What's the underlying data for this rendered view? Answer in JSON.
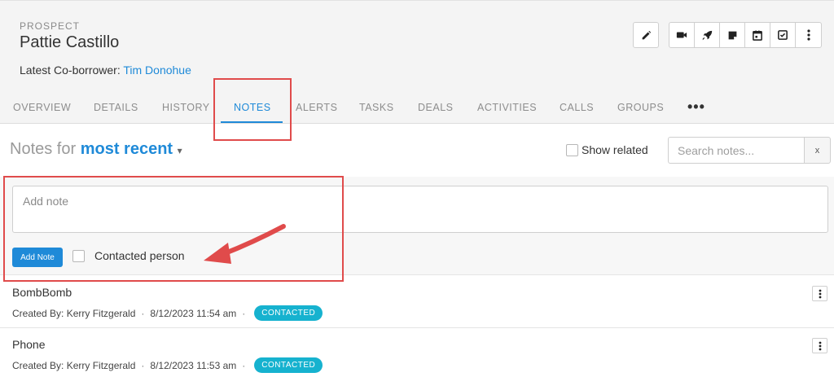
{
  "record": {
    "type_label": "PROSPECT",
    "name": "Pattie Castillo",
    "coborrower_label": "Latest Co-borrower:",
    "coborrower_name": "Tim Donohue"
  },
  "actions": {
    "edit": "pencil-icon",
    "group": [
      "video-icon",
      "rocket-icon",
      "note-icon",
      "calendar-icon",
      "check-square-icon",
      "more-vertical-icon"
    ]
  },
  "tabs": [
    {
      "label": "OVERVIEW",
      "active": false
    },
    {
      "label": "DETAILS",
      "active": false
    },
    {
      "label": "HISTORY",
      "active": false
    },
    {
      "label": "NOTES",
      "active": true
    },
    {
      "label": "ALERTS",
      "active": false
    },
    {
      "label": "TASKS",
      "active": false
    },
    {
      "label": "DEALS",
      "active": false
    },
    {
      "label": "ACTIVITIES",
      "active": false
    },
    {
      "label": "CALLS",
      "active": false
    },
    {
      "label": "GROUPS",
      "active": false
    }
  ],
  "tabs_more": "•••",
  "notes_header": {
    "prefix": "Notes for",
    "filter": "most recent",
    "caret": "▾",
    "show_related_label": "Show related",
    "search_placeholder": "Search notes...",
    "clear": "x"
  },
  "compose": {
    "placeholder": "Add note",
    "add_button": "Add Note",
    "contacted_label": "Contacted person"
  },
  "notes": [
    {
      "title": "BombBomb",
      "created_by": "Created By: Kerry Fitzgerald",
      "timestamp": "8/12/2023 11:54 am",
      "badge": "CONTACTED"
    },
    {
      "title": "Phone",
      "created_by": "Created By: Kerry Fitzgerald",
      "timestamp": "8/12/2023 11:53 am",
      "badge": "CONTACTED"
    }
  ],
  "colors": {
    "accent": "#1f8ad8",
    "badge": "#16b2cf",
    "annotation": "#e04b4b"
  }
}
